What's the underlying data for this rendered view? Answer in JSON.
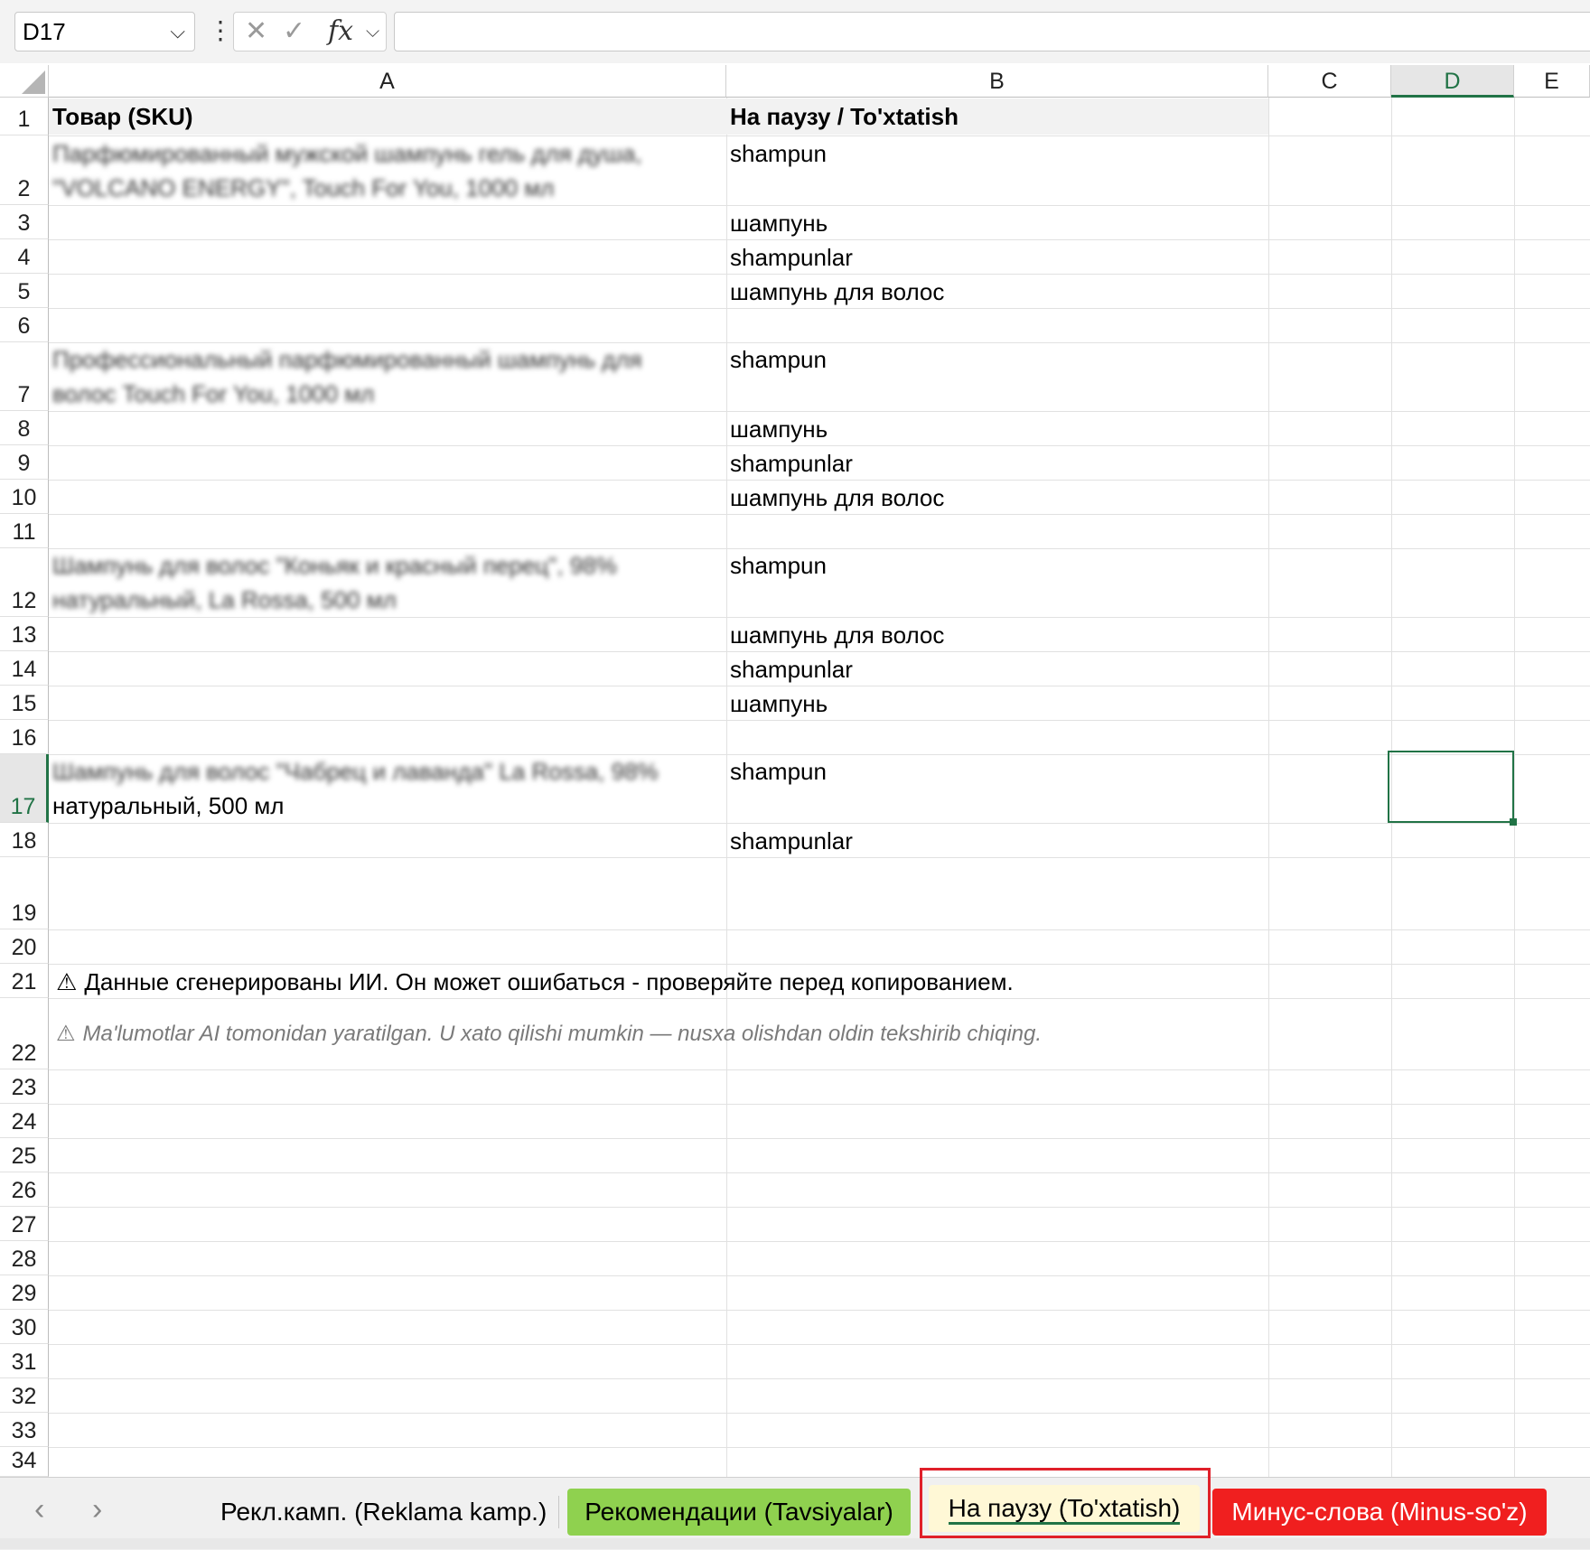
{
  "formula_bar": {
    "name_box": "D17",
    "cancel_icon": "✕",
    "enter_icon": "✓",
    "fx_label": "fx",
    "formula_value": ""
  },
  "columns": [
    "A",
    "B",
    "C",
    "D",
    "E"
  ],
  "selected_column": "D",
  "rows": [
    "1",
    "2",
    "3",
    "4",
    "5",
    "6",
    "7",
    "8",
    "9",
    "10",
    "11",
    "12",
    "13",
    "14",
    "15",
    "16",
    "17",
    "18",
    "19",
    "20",
    "21",
    "22",
    "23",
    "24",
    "25",
    "26",
    "27",
    "28",
    "29",
    "30",
    "31",
    "32",
    "33",
    "34"
  ],
  "selected_row": "17",
  "cells": {
    "A1": "Товар (SKU)",
    "B1": "На паузу / To'xtatish",
    "A2": "Парфюмированный мужской шампунь гель для душа, \"VOLCANO ENERGY\", Touch For You, 1000 мл",
    "B2": "shampun",
    "B3": "шампунь",
    "B4": "shampunlar",
    "B5": "шампунь для волос",
    "A7": "Профессиональный парфюмированный шампунь для волос Touch For You, 1000 мл",
    "B7": "shampun",
    "B8": "шампунь",
    "B9": "shampunlar",
    "B10": "шампунь для волос",
    "A12": "Шампунь для волос \"Коньяк и красный перец\", 98% натуральный, La Rossa, 500 мл",
    "B12": "shampun",
    "B13": "шампунь для волос",
    "B14": "shampunlar",
    "B15": "шампунь",
    "A17_line1": "Шампунь для волос \"Чабрец и лаванда\" La Rossa, 98%",
    "A17_line2": "натуральный, 500 мл",
    "B17": "shampun",
    "B18": "shampunlar",
    "A21": "Данные сгенерированы ИИ. Он может ошибаться - проверяйте перед копированием.",
    "A22": "Ma'lumotlar AI tomonidan yaratilgan. U xato qilishi mumkin — nusxa olishdan oldin tekshirib chiqing."
  },
  "warning_icon": "⚠",
  "sheet_tabs": [
    {
      "label": "Рекл.камп. (Reklama kamp.)",
      "color": "#f0f0f0",
      "active": false
    },
    {
      "label": "Рекомендации (Tavsiyalar)",
      "color": "#8fd14f",
      "active": false
    },
    {
      "label": "На паузу (To'xtatish)",
      "color": "#fff8d6",
      "active": true
    },
    {
      "label": "Минус-слова (Minus-so'z)",
      "color": "#f01f1f",
      "active": false
    }
  ],
  "colors": {
    "accent": "#217346",
    "highlight": "#e0202a"
  }
}
